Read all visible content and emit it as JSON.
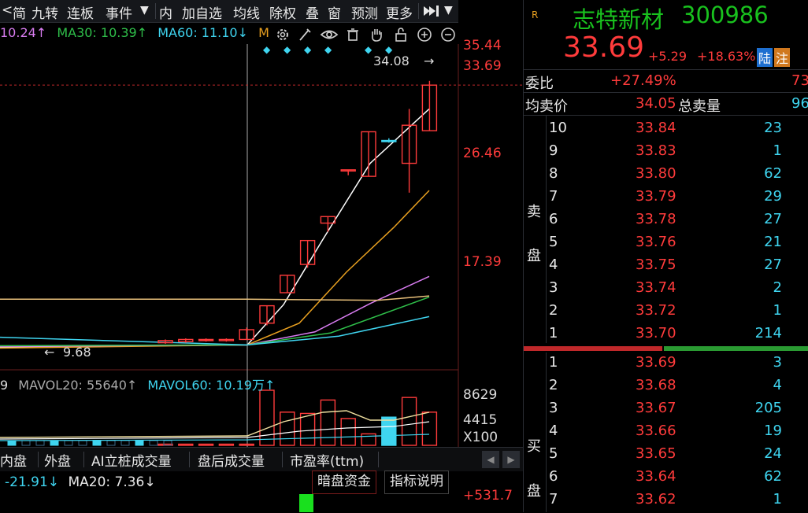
{
  "toolbar": {
    "items": [
      "简",
      "九转",
      "连板",
      "事件",
      "▼",
      "内",
      "加自选",
      "均线",
      "除权",
      "叠",
      "窗",
      "预测",
      "更多"
    ],
    "left_arrow": "<",
    "collapse_icon": "collapse-right-icon",
    "dropdown": "▼"
  },
  "ma_legend": {
    "ma20": "10.24↑",
    "ma30": "MA30: 10.39↑",
    "ma60": "MA60: 11.10↓",
    "more": "M"
  },
  "stock": {
    "tag": "R",
    "name": "志特新材",
    "code": "300986",
    "price": "33.69",
    "change": "+5.29",
    "change_pct": "+18.63%",
    "badge1": "陆",
    "badge2": "注"
  },
  "ratios": {
    "weibi_label": "委比",
    "weibi_value": "+27.49%",
    "weibi_extra": "73",
    "avg_sell_label": "均卖价",
    "avg_sell_value": "34.05",
    "total_sell_label": "总卖量",
    "total_sell_value": "96"
  },
  "sell_side_label": [
    "卖",
    "盘"
  ],
  "buy_side_label": [
    "买",
    "盘"
  ],
  "sell_orders": [
    {
      "level": "10",
      "price": "33.84",
      "vol": "23"
    },
    {
      "level": "9",
      "price": "33.83",
      "vol": "1"
    },
    {
      "level": "8",
      "price": "33.80",
      "vol": "62"
    },
    {
      "level": "7",
      "price": "33.79",
      "vol": "29"
    },
    {
      "level": "6",
      "price": "33.78",
      "vol": "27"
    },
    {
      "level": "5",
      "price": "33.76",
      "vol": "21"
    },
    {
      "level": "4",
      "price": "33.75",
      "vol": "27"
    },
    {
      "level": "3",
      "price": "33.74",
      "vol": "2"
    },
    {
      "level": "2",
      "price": "33.72",
      "vol": "1"
    },
    {
      "level": "1",
      "price": "33.70",
      "vol": "214"
    }
  ],
  "buy_orders": [
    {
      "level": "1",
      "price": "33.69",
      "vol": "3"
    },
    {
      "level": "2",
      "price": "33.68",
      "vol": "4"
    },
    {
      "level": "3",
      "price": "33.67",
      "vol": "205"
    },
    {
      "level": "4",
      "price": "33.66",
      "vol": "19"
    },
    {
      "level": "5",
      "price": "33.65",
      "vol": "24"
    },
    {
      "level": "6",
      "price": "33.64",
      "vol": "62"
    },
    {
      "level": "7",
      "price": "33.62",
      "vol": "1"
    }
  ],
  "price_axis": {
    "high": "35.44",
    "current": "33.69",
    "mid1": "26.46",
    "mid2": "17.39",
    "peak_marker": "34.08",
    "low_marker": "9.68"
  },
  "volume": {
    "legend_left": "9",
    "mavol20": "MAVOL20: 55640↑",
    "mavol60": "MAVOL60: 10.19万↑",
    "axis_top": "8629",
    "axis_mid": "4415",
    "axis_unit": "X100"
  },
  "bottom_tabs": [
    "内盘",
    "外盘",
    "AI立桩成交量",
    "盘后成交量",
    "市盈率(ttm)"
  ],
  "indicator": {
    "value1": "-21.91↓",
    "ma20": "MA20: 7.36↓",
    "btn_dark_pool": "暗盘资金",
    "btn_explain": "指标说明",
    "right_value": "+531.7"
  },
  "colors": {
    "up": "#ff3b3b",
    "down": "#19c11e",
    "cyan": "#3fd5f0",
    "name_green": "#19c11e"
  },
  "chart_data": {
    "type": "candlestick",
    "title": "",
    "ylim": [
      9.68,
      35.44
    ],
    "candles": [
      {
        "open": 10.0,
        "close": 10.2,
        "high": 10.3,
        "low": 9.9
      },
      {
        "open": 10.1,
        "close": 10.3,
        "high": 10.4,
        "low": 10.0
      },
      {
        "open": 10.3,
        "close": 10.2,
        "high": 10.4,
        "low": 10.1
      },
      {
        "open": 10.2,
        "close": 10.3,
        "high": 10.4,
        "low": 10.1
      },
      {
        "open": 10.3,
        "close": 11.2,
        "high": 11.4,
        "low": 10.3
      },
      {
        "open": 11.8,
        "close": 13.4,
        "high": 13.4,
        "low": 11.6
      },
      {
        "open": 14.6,
        "close": 16.2,
        "high": 16.2,
        "low": 14.6
      },
      {
        "open": 17.2,
        "close": 19.4,
        "high": 19.4,
        "low": 16.9
      },
      {
        "open": 21.0,
        "close": 21.6,
        "high": 21.6,
        "low": 20.2
      },
      {
        "open": 25.9,
        "close": 25.9,
        "high": 25.9,
        "low": 25.4
      },
      {
        "open": 25.3,
        "close": 29.4,
        "high": 29.4,
        "low": 25.3
      },
      {
        "open": 28.6,
        "close": 28.6,
        "high": 28.8,
        "low": 28.4
      },
      {
        "open": 26.5,
        "close": 30.0,
        "high": 31.5,
        "low": 23.8
      },
      {
        "open": 29.5,
        "close": 33.69,
        "high": 34.08,
        "low": 29.5
      }
    ],
    "volumes": [
      0.4,
      0.5,
      0.3,
      0.4,
      1.5,
      86.29,
      52.0,
      50.0,
      71.0,
      42.0,
      18.0,
      44.15,
      75.0,
      52.0
    ]
  }
}
